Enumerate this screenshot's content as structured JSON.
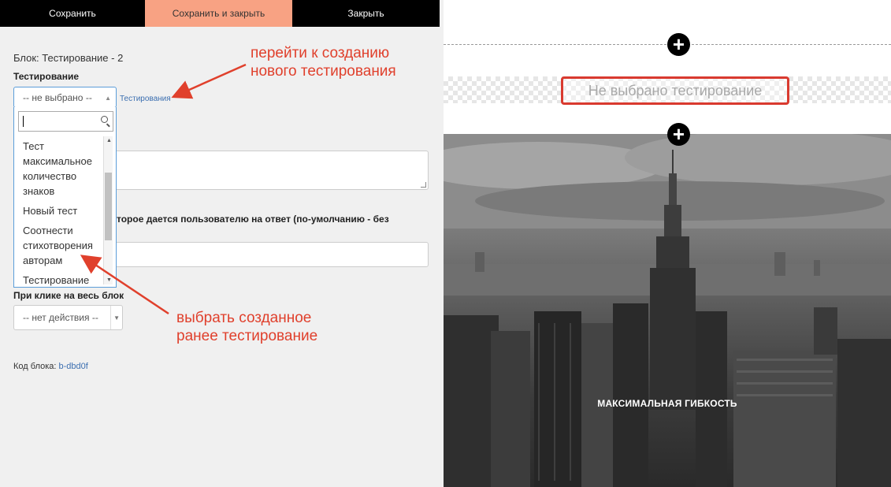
{
  "toolbar": {
    "save": "Сохранить",
    "save_close": "Сохранить и закрыть",
    "close": "Закрыть"
  },
  "editor": {
    "block_title": "Блок: Тестирование - 2",
    "test_label": "Тестирование",
    "test_select": {
      "value": "-- не выбрано --",
      "create_link": "Тестирования",
      "search_placeholder": "",
      "options": [
        "Тест максимальное количество знаков",
        "Новый тест",
        "Соотнести стихотворения авторам",
        "Тестирование"
      ]
    },
    "time_label_partial": "торое дается пользователю на ответ (по-умолчанию - без",
    "click_label": "При клике на весь блок",
    "click_select_value": "-- нет действия --",
    "block_code_label": "Код блока:",
    "block_code_value": "b-dbd0f"
  },
  "annotations": {
    "top": "перейти к созданию\nнового тестирования",
    "bottom": "выбрать созданное\nранее тестирование",
    "color": "#e0402c"
  },
  "preview": {
    "placeholder": "Не выбрано тестирование",
    "hero_title": "МАКСИМАЛЬНАЯ ГИБКОСТЬ",
    "highlight_color": "#d93a2f"
  },
  "colors": {
    "toolbar_dark": "#000000",
    "toolbar_accent": "#f8a283",
    "link": "#3c6fb0"
  }
}
